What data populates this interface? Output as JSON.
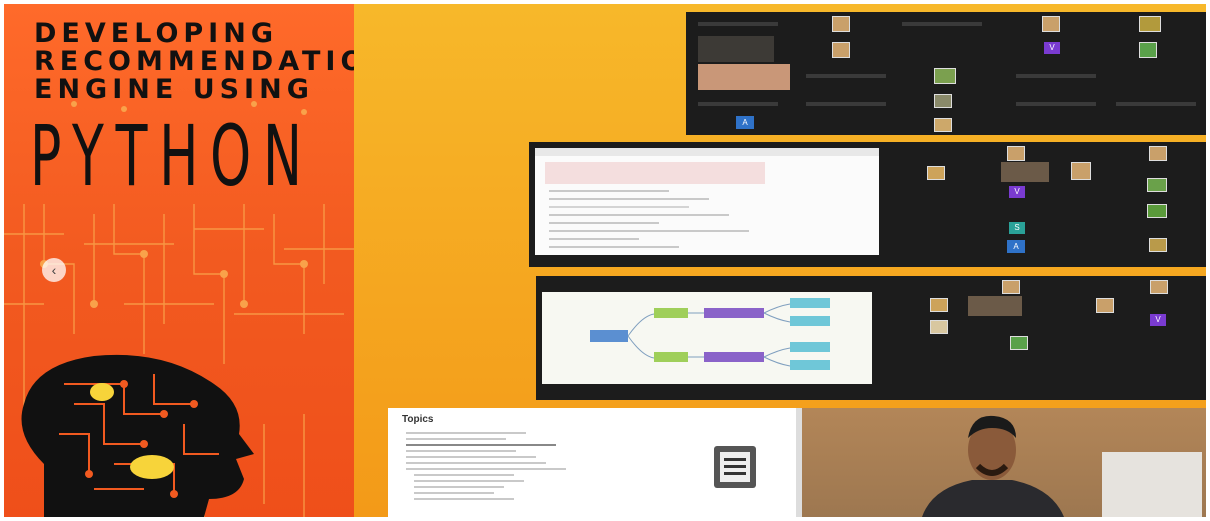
{
  "poster": {
    "line1": "DEVELOPING",
    "line2": "RECOMMENDATION",
    "line3": "ENGINE USING",
    "line4": "PYTHON",
    "prev_glyph": "‹"
  },
  "shots": {
    "topics_title": "Topics",
    "chips": {
      "v": "V",
      "a": "A",
      "s": "S"
    }
  },
  "colors": {
    "poster": "#f25a20",
    "background": "#f7b527",
    "panel": "#1c1c1c"
  }
}
